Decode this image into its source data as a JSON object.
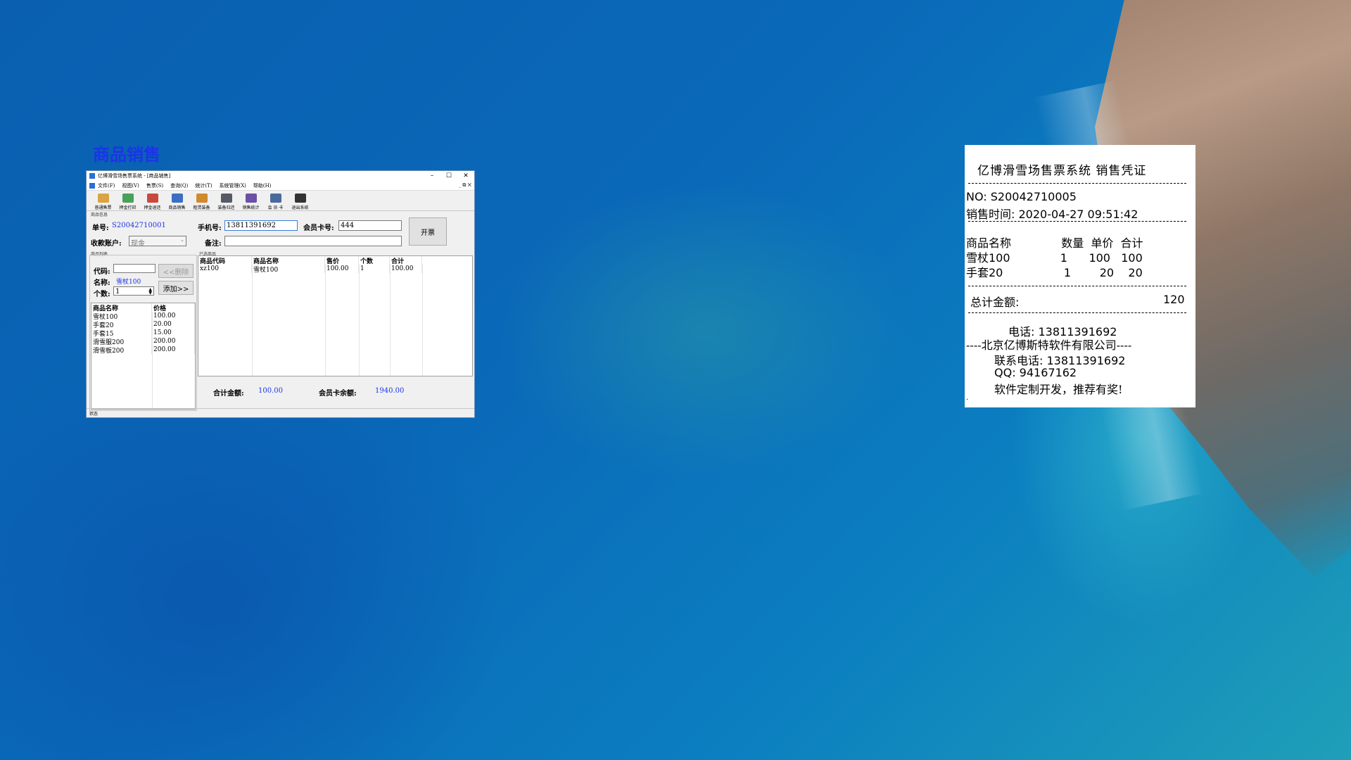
{
  "caption": "商品销售",
  "window": {
    "title": "亿博滑雪场售票系统 - [商品销售]",
    "controls": [
      "–",
      "☐",
      "✕"
    ],
    "menu": [
      "文件(F)",
      "视图(V)",
      "售票(S)",
      "查询(Q)",
      "统计(T)",
      "系统管理(X)",
      "帮助(H)"
    ],
    "menu_right": "_ ⧉ ✕",
    "toolbar": [
      {
        "label": "普通售票",
        "color": "#d9a441"
      },
      {
        "label": "押金打印",
        "color": "#4aa15a"
      },
      {
        "label": "押金退还",
        "color": "#c94a3d"
      },
      {
        "label": "商品销售",
        "color": "#3a6fc4"
      },
      {
        "label": "租赁装备",
        "color": "#d08a2c"
      },
      {
        "label": "装备归还",
        "color": "#555a66"
      },
      {
        "label": "销售统计",
        "color": "#6b4fa8"
      },
      {
        "label": "会 员 卡",
        "color": "#4a6a9c"
      },
      {
        "label": "退出系统",
        "color": "#333333"
      }
    ],
    "section_info": "商品信息",
    "order_no_label": "单号:",
    "order_no": "S20042710001",
    "phone_label": "手机号:",
    "phone": "13811391692",
    "card_label": "会员卡号:",
    "card": "444",
    "issue_button": "开票",
    "account_label": "收款账户:",
    "account": "现金",
    "remark_label": "备注:",
    "remark": "",
    "section_list": "商品列表",
    "code_label": "代码:",
    "code": "",
    "name_label": "名称:",
    "name": "雪杖100",
    "qty_label": "个数:",
    "qty": "1",
    "delete_button": "<<删除",
    "add_button": "添加>>",
    "products_header": [
      "商品名称",
      "价格"
    ],
    "products": [
      [
        "雪杖100",
        "100.00"
      ],
      [
        "手套20",
        "20.00"
      ],
      [
        "手套15",
        "15.00"
      ],
      [
        "滑雪服200",
        "200.00"
      ],
      [
        "滑雪板200",
        "200.00"
      ]
    ],
    "section_selected": "已选商品",
    "selected_header": [
      "商品代码",
      "商品名称",
      "售价",
      "个数",
      "合计"
    ],
    "selected": [
      [
        "xz100",
        "雪杖100",
        "100.00",
        "1",
        "100.00"
      ]
    ],
    "total_label": "合计金额:",
    "total": "100.00",
    "balance_label": "会员卡余额:",
    "balance": "1940.00",
    "status": "状态"
  },
  "receipt": {
    "title": "亿博滑雪场售票系统 销售凭证",
    "no_line": "NO:  S20042710005",
    "time_line": "销售时间:  2020-04-27 09:51:42",
    "header": "商品名称              数量  单价  合计",
    "items": [
      "雪杖100              1      100   100",
      "手套20                 1        20    20"
    ],
    "total_label": "总计金额:",
    "total": "120",
    "phone_line": "电话:  13811391692",
    "company_line": "----北京亿博斯特软件有限公司----",
    "contact_line": "联系电话:  13811391692",
    "qq_line": "QQ:  94167162",
    "slogan": "软件定制开发，推荐有奖!",
    "end_mark": "."
  }
}
